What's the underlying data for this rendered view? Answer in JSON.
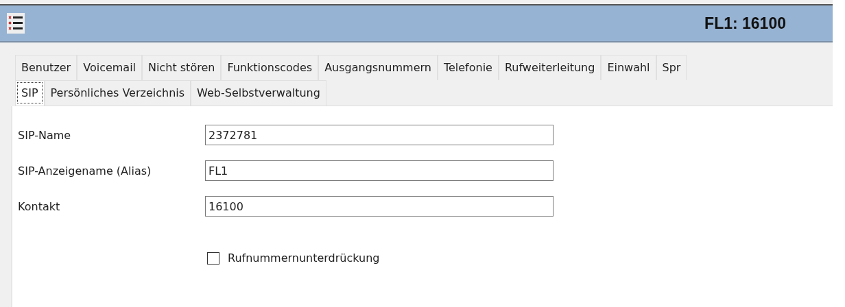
{
  "window": {
    "title": "FL1: 16100"
  },
  "tab_rows": [
    [
      {
        "label": "Benutzer",
        "selected": false
      },
      {
        "label": "Voicemail",
        "selected": false
      },
      {
        "label": "Nicht stören",
        "selected": false
      },
      {
        "label": "Funktionscodes",
        "selected": false
      },
      {
        "label": "Ausgangsnummern",
        "selected": false
      },
      {
        "label": "Telefonie",
        "selected": false
      },
      {
        "label": "Rufweiterleitung",
        "selected": false
      },
      {
        "label": "Einwahl",
        "selected": false
      },
      {
        "label": "Spr",
        "selected": false
      }
    ],
    [
      {
        "label": "SIP",
        "selected": true
      },
      {
        "label": "Persönliches Verzeichnis",
        "selected": false
      },
      {
        "label": "Web-Selbstverwaltung",
        "selected": false
      }
    ]
  ],
  "fields": [
    {
      "label": "SIP-Name",
      "value": "2372781"
    },
    {
      "label": "SIP-Anzeigename (Alias)",
      "value": "FL1"
    },
    {
      "label": "Kontakt",
      "value": "16100"
    }
  ],
  "checkbox": {
    "label": "Rufnummernunterdrückung",
    "checked": false
  }
}
